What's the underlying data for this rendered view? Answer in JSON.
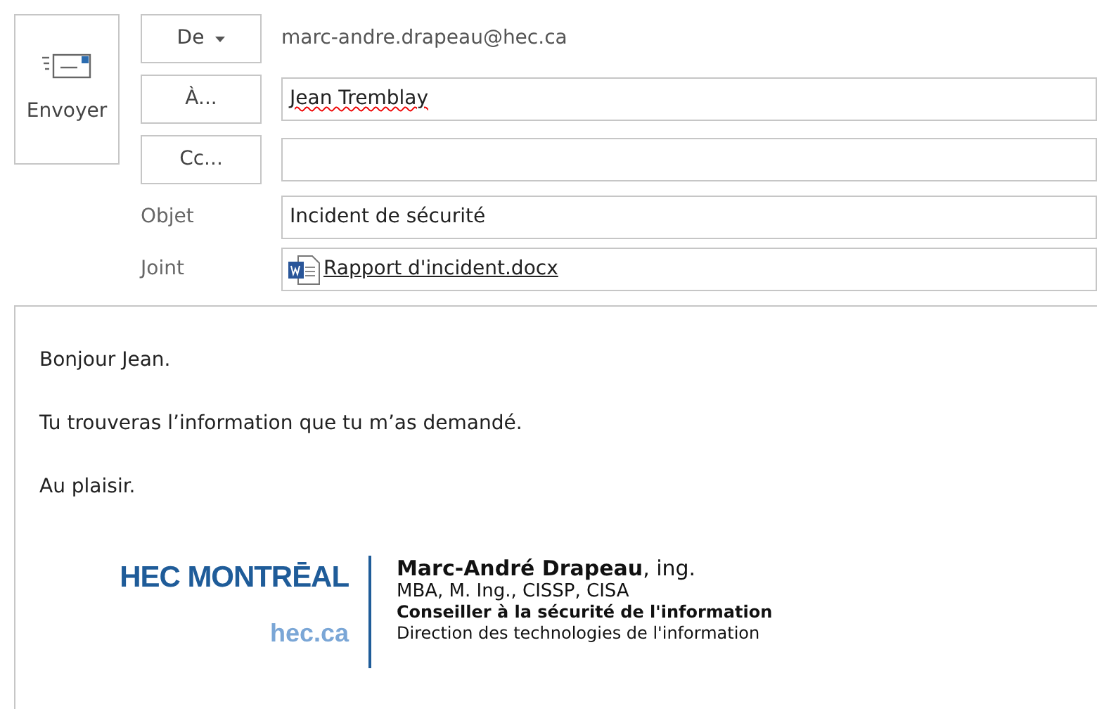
{
  "send_button": {
    "label": "Envoyer"
  },
  "from": {
    "button": "De",
    "value": "marc-andre.drapeau@hec.ca"
  },
  "to": {
    "button": "À...",
    "value": "Jean Tremblay",
    "misspelled": true
  },
  "cc": {
    "button": "Cc..."
  },
  "subject": {
    "label": "Objet",
    "value": "Incident de sécurité"
  },
  "attachment": {
    "label": "Joint",
    "file": "Rapport d'incident.docx"
  },
  "body": {
    "paragraphs": [
      "Bonjour Jean.",
      "Tu trouveras l’information que tu m’as demandé.",
      "Au plaisir."
    ],
    "signature": {
      "logo": "HEC MONTRĒAL",
      "website": "hec.ca",
      "name": "**Marc-André Drapeau**, ing.",
      "credentials": "MBA, M. Ing., CISSP, CISA",
      "title": "Conseiller à la sécurité de l'information",
      "department": "Direction des technologies de l'information"
    }
  }
}
